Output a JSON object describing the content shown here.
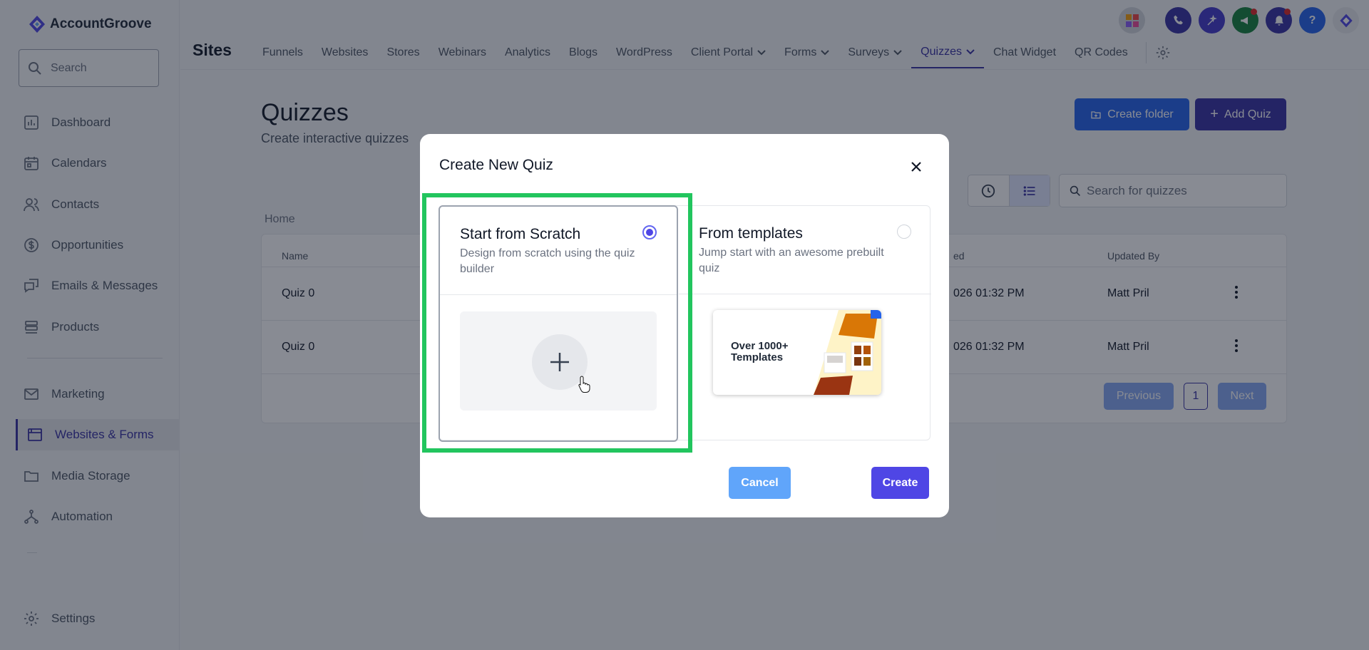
{
  "app": {
    "brand": "AccountGroove",
    "section_title": "Sites"
  },
  "sidebar": {
    "search_placeholder": "Search",
    "items": [
      {
        "label": "Dashboard",
        "icon": "dashboard-icon"
      },
      {
        "label": "Calendars",
        "icon": "calendar-icon"
      },
      {
        "label": "Contacts",
        "icon": "contacts-icon"
      },
      {
        "label": "Opportunities",
        "icon": "dollar-icon"
      },
      {
        "label": "Emails & Messages",
        "icon": "messages-icon"
      },
      {
        "label": "Products",
        "icon": "products-icon"
      },
      {
        "label": "Marketing",
        "icon": "mail-icon"
      },
      {
        "label": "Websites & Forms",
        "icon": "website-icon",
        "active": true
      },
      {
        "label": "Media Storage",
        "icon": "folder-icon"
      },
      {
        "label": "Automation",
        "icon": "automation-icon"
      },
      {
        "label": "Settings",
        "icon": "gear-icon"
      }
    ]
  },
  "nav": {
    "tabs": [
      {
        "label": "Funnels"
      },
      {
        "label": "Websites"
      },
      {
        "label": "Stores"
      },
      {
        "label": "Webinars"
      },
      {
        "label": "Analytics"
      },
      {
        "label": "Blogs"
      },
      {
        "label": "WordPress"
      },
      {
        "label": "Client Portal",
        "dropdown": true
      },
      {
        "label": "Forms",
        "dropdown": true
      },
      {
        "label": "Surveys",
        "dropdown": true
      },
      {
        "label": "Quizzes",
        "dropdown": true,
        "active": true
      },
      {
        "label": "Chat Widget"
      },
      {
        "label": "QR Codes"
      }
    ]
  },
  "page": {
    "title": "Quizzes",
    "subtitle": "Create interactive quizzes",
    "create_folder_label": "Create folder",
    "add_quiz_label": "Add Quiz",
    "search_placeholder": "Search for quizzes",
    "breadcrumb": "Home",
    "table": {
      "col_name": "Name",
      "col_updated_partial": "ed",
      "col_updated_by": "Updated By",
      "rows": [
        {
          "name": "Quiz 0",
          "updated": "026 01:32 PM",
          "updated_by": "Matt Pril"
        },
        {
          "name": "Quiz 0",
          "updated": "026 01:32 PM",
          "updated_by": "Matt Pril"
        }
      ]
    },
    "pagination": {
      "previous": "Previous",
      "page": "1",
      "next": "Next"
    }
  },
  "modal": {
    "title": "Create New Quiz",
    "option_scratch": {
      "title": "Start from Scratch",
      "description": "Design from scratch using the quiz builder",
      "selected": true
    },
    "option_templates": {
      "title": "From templates",
      "description": "Jump start with an awesome prebuilt quiz",
      "preview_text": "Over 1000+ Templates",
      "selected": false
    },
    "cancel_label": "Cancel",
    "create_label": "Create"
  },
  "colors": {
    "primary": "#3730a3",
    "blue": "#2563eb",
    "highlight": "#22c55e",
    "create_button": "#4f46e5",
    "cancel_button": "#60a5fa"
  }
}
